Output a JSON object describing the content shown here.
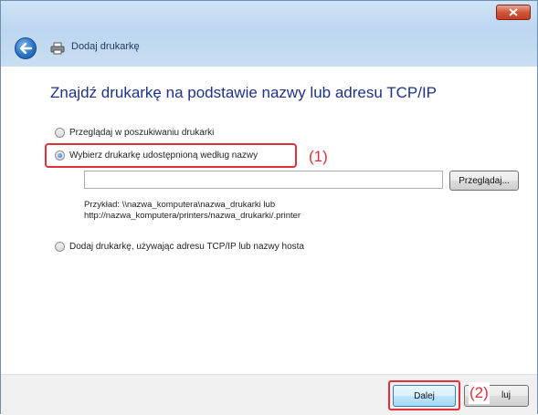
{
  "window": {
    "title": "Dodaj drukarkę",
    "close_icon": "close-icon",
    "back_icon": "back-arrow-icon",
    "printer_icon": "printer-icon"
  },
  "main": {
    "heading": "Znajdź drukarkę na podstawie nazwy lub adresu TCP/IP",
    "options": [
      {
        "label": "Przeglądaj w poszukiwaniu drukarki",
        "selected": false
      },
      {
        "label": "Wybierz drukarkę udostępnioną według nazwy",
        "selected": true
      },
      {
        "label": "Dodaj drukarkę, używając adresu TCP/IP lub nazwy hosta",
        "selected": false
      }
    ],
    "printer_name_value": "",
    "browse_label": "Przeglądaj...",
    "example_line1": "Przykład: \\\\nazwa_komputera\\nazwa_drukarki lub",
    "example_line2": "http://nazwa_komputera/printers/nazwa_drukarki/.printer"
  },
  "annotations": {
    "callout_1": "(1)",
    "callout_2": "(2)",
    "highlight_color": "#e0303a"
  },
  "footer": {
    "next_label": "Dalej",
    "cancel_label_visible": "luj"
  }
}
